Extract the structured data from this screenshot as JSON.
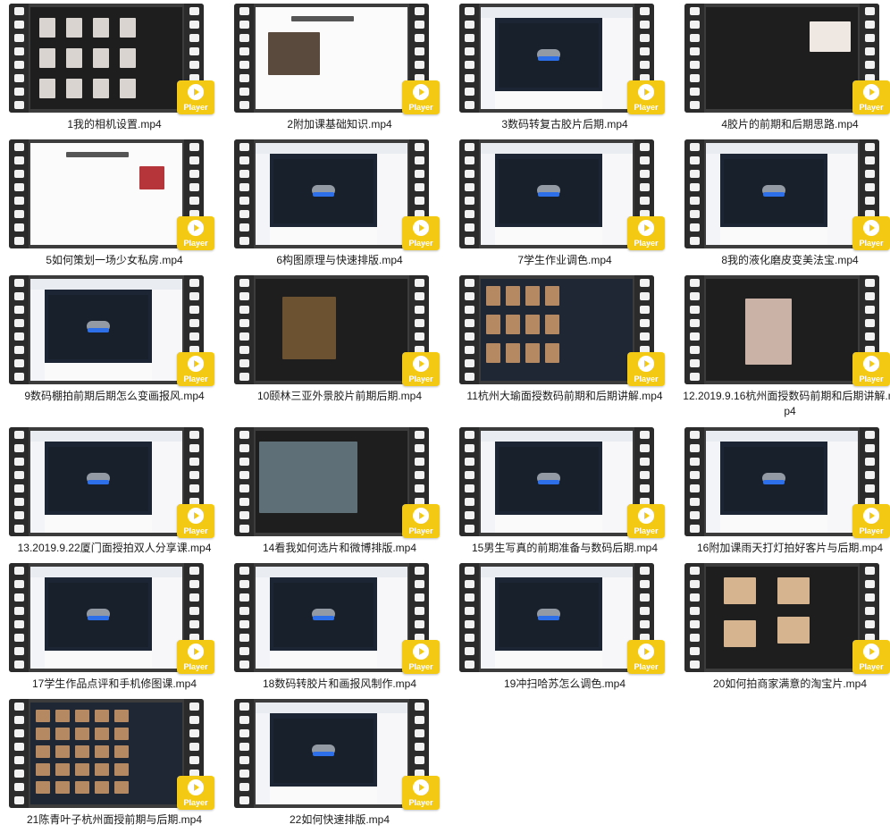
{
  "player_label": "Player",
  "files": [
    {
      "name": "1我的相机设置.mp4",
      "screen": "dark-grid"
    },
    {
      "name": "2附加课基础知识.mp4",
      "screen": "slide"
    },
    {
      "name": "3数码转复古胶片后期.mp4",
      "screen": "chat"
    },
    {
      "name": "4胶片的前期和后期思路.mp4",
      "screen": "editor"
    },
    {
      "name": "5如何策划一场少女私房.mp4",
      "screen": "slide2"
    },
    {
      "name": "6构图原理与快速排版.mp4",
      "screen": "chat"
    },
    {
      "name": "7学生作业调色.mp4",
      "screen": "chat"
    },
    {
      "name": "8我的液化磨皮变美法宝.mp4",
      "screen": "chat"
    },
    {
      "name": "9数码棚拍前期后期怎么变画报风.mp4",
      "screen": "chat"
    },
    {
      "name": "10颐林三亚外景胶片前期后期.mp4",
      "screen": "photoshop"
    },
    {
      "name": "11杭州大瑜面授数码前期和后期讲解.mp4",
      "screen": "lightroom"
    },
    {
      "name": "12.2019.9.16杭州面授数码前期和后期讲解.mp4",
      "screen": "photoshop2"
    },
    {
      "name": "13.2019.9.22厦门面授拍双人分享课.mp4",
      "screen": "chat"
    },
    {
      "name": "14看我如何选片和微博排版.mp4",
      "screen": "beach"
    },
    {
      "name": "15男生写真的前期准备与数码后期.mp4",
      "screen": "chat"
    },
    {
      "name": "16附加课雨天打灯拍好客片与后期.mp4",
      "screen": "chat"
    },
    {
      "name": "17学生作品点评和手机修图课.mp4",
      "screen": "chat"
    },
    {
      "name": "18数码转胶片和画报风制作.mp4",
      "screen": "chat"
    },
    {
      "name": "19冲扫哈苏怎么调色.mp4",
      "screen": "chat"
    },
    {
      "name": "20如何拍商家满意的淘宝片.mp4",
      "screen": "collage"
    },
    {
      "name": "21陈青叶子杭州面授前期与后期.mp4",
      "screen": "contact"
    },
    {
      "name": "22如何快速排版.mp4",
      "screen": "chat"
    }
  ]
}
